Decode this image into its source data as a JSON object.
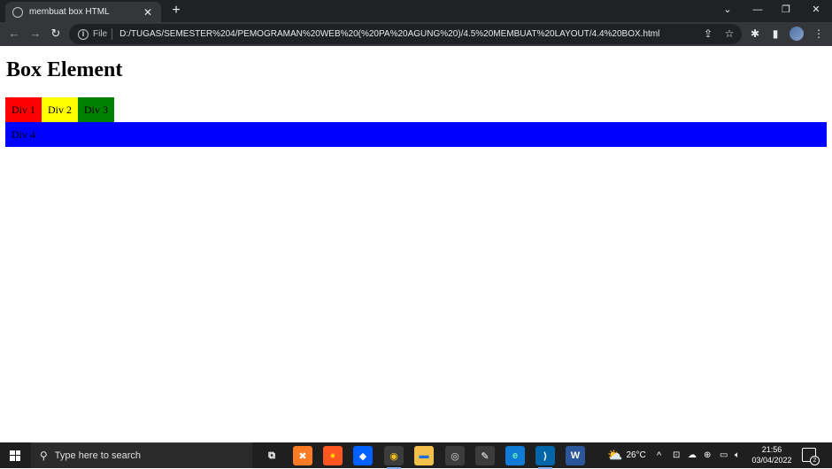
{
  "browser": {
    "tab": {
      "title": "membuat box HTML",
      "close": "✕",
      "favicon": "globe-icon"
    },
    "new_tab": "+",
    "window_controls": {
      "minimize": "—",
      "restore": "❐",
      "close": "✕"
    },
    "toolbar": {
      "back": "←",
      "forward": "→",
      "reload": "↻",
      "scheme_label": "File",
      "url": "D:/TUGAS/SEMESTER%204/PEMOGRAMAN%20WEB%20(%20PA%20AGUNG%20)/4.5%20MEMBUAT%20LAYOUT/4.4%20BOX.html",
      "share": "⇪",
      "bookmark": "☆",
      "extensions": "✱",
      "sidepanel": "▮",
      "menu": "⋮"
    }
  },
  "page": {
    "heading": "Box Element",
    "boxes": [
      {
        "label": "Div 1",
        "color": "#ff0000"
      },
      {
        "label": "Div 2",
        "color": "#ffff00"
      },
      {
        "label": "Div 3",
        "color": "#008000"
      },
      {
        "label": "Div 4",
        "color": "#0000ff"
      }
    ]
  },
  "taskbar": {
    "search_placeholder": "Type here to search",
    "apps": [
      {
        "name": "task-view-icon",
        "glyph": "⧉"
      },
      {
        "name": "xampp-icon",
        "glyph": "✖"
      },
      {
        "name": "firefox-icon",
        "glyph": "●"
      },
      {
        "name": "dropbox-icon",
        "glyph": "◆"
      },
      {
        "name": "chrome-icon",
        "glyph": "◉"
      },
      {
        "name": "file-explorer-icon",
        "glyph": "▬"
      },
      {
        "name": "obs-icon",
        "glyph": "◎"
      },
      {
        "name": "inkscape-icon",
        "glyph": "✎"
      },
      {
        "name": "edge-icon",
        "glyph": "e"
      },
      {
        "name": "vscode-icon",
        "glyph": "⟩"
      },
      {
        "name": "word-icon",
        "glyph": "W"
      }
    ],
    "weather": "26°C",
    "time": "21:56",
    "date": "03/04/2022",
    "notification_count": "2"
  }
}
